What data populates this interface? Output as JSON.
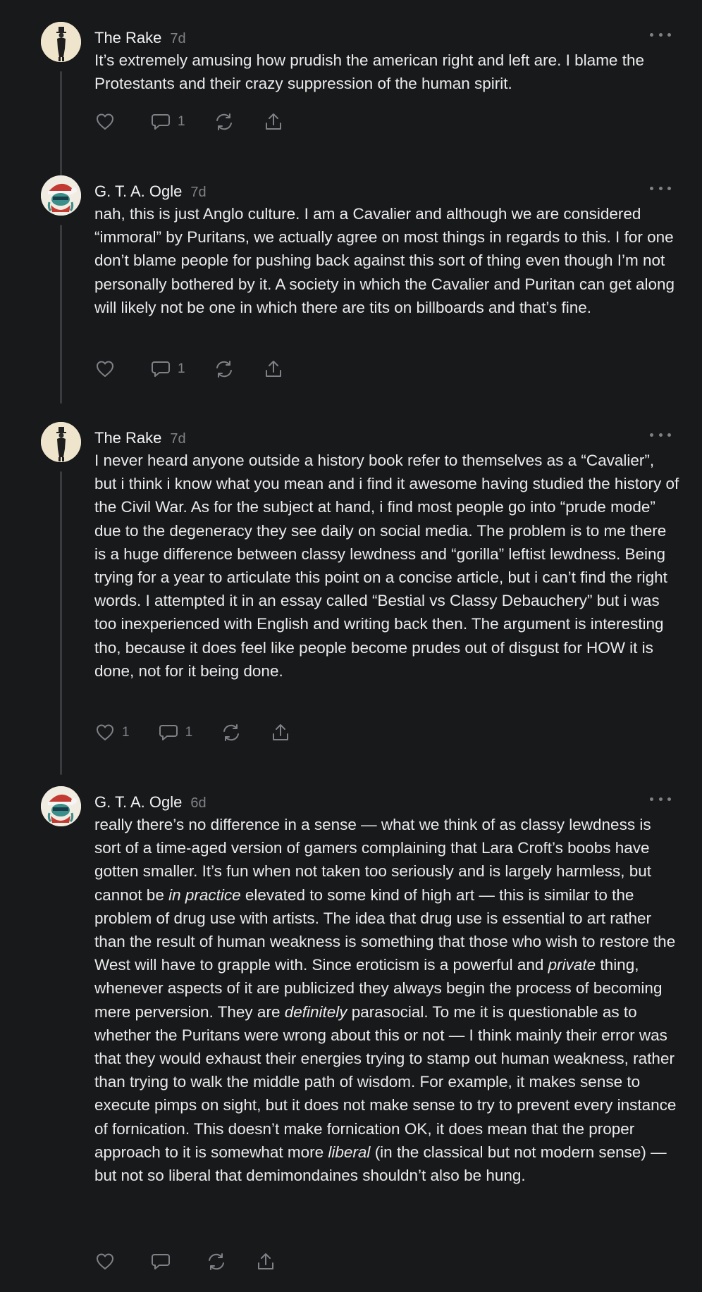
{
  "comments": [
    {
      "author": "The Rake",
      "time": "7d",
      "text": "It’s extremely amusing how prudish the american right and left are. I blame the Protestants and their crazy suppression of the human spirit.",
      "likes": "",
      "replies": "1"
    },
    {
      "author": "G. T. A. Ogle",
      "time": "7d",
      "text": "nah, this is just Anglo culture. I am a Cavalier and although we are considered “immoral” by Puritans, we actually agree on most things in regards to this. I for one don’t blame people for pushing back against this sort of thing even though I’m not personally bothered by it. A society in which the Cavalier and Puritan can get along will likely not be one in which there are tits on billboards and that’s fine.",
      "likes": "",
      "replies": "1"
    },
    {
      "author": "The Rake",
      "time": "7d",
      "text": "I never heard anyone outside a history book refer to themselves as a “Cavalier”, but i think i know what you mean and i find it awesome having studied the history of the Civil War. As for the subject at hand, i find most people go into “prude mode” due to the degeneracy they see daily on social media. The problem is to me there is a huge difference between classy lewdness and “gorilla” leftist lewdness. Being trying for a year to articulate this point on a concise article, but i can’t find the right words. I attempted it in an essay called “Bestial vs Classy Debauchery” but i was too inexperienced with English and writing back then. The argument is interesting tho, because it does feel like people become prudes out of disgust for HOW it is done, not for it being done.",
      "likes": "1",
      "replies": "1"
    },
    {
      "author": "G. T. A. Ogle",
      "time": "6d",
      "text_parts": [
        "really there’s no difference in a sense — what we think of as classy lewdness is sort of a time-aged version of gamers complaining that Lara Croft’s boobs have gotten smaller. It’s fun when not taken too seriously and is largely harmless, but cannot be ",
        "in practice",
        " elevated to some kind of high art — this is similar to the problem of drug use with artists. The idea that drug use is essential to art rather than the result of human weakness is something that those who wish to restore the West will have to grapple with. Since eroticism is a powerful and ",
        "private",
        " thing, whenever aspects of it are publicized they always begin the process of becoming mere perversion. They are ",
        "definitely",
        " parasocial. To me it is questionable as to whether the Puritans were wrong about this or not — I think mainly their error was that they would exhaust their energies trying to stamp out human weakness, rather than trying to walk the middle path of wisdom. For example, it makes sense to execute pimps on sight, but it does not make sense to try to prevent every instance of fornication. This doesn’t make fornication OK, it does mean that the proper approach to it is somewhat more ",
        "liberal",
        " (in the classical but not modern sense) — but not so liberal that demimondaines shouldn’t also be hung."
      ],
      "likes": "",
      "replies": ""
    }
  ],
  "icons": {
    "like": "heart-icon",
    "reply": "comment-icon",
    "restack": "restack-icon",
    "share": "share-icon",
    "more": "ellipsis-icon"
  },
  "colors": {
    "background": "#18191b",
    "text": "#ebebec",
    "muted": "#818286",
    "thread_line": "#3a3b3e"
  }
}
